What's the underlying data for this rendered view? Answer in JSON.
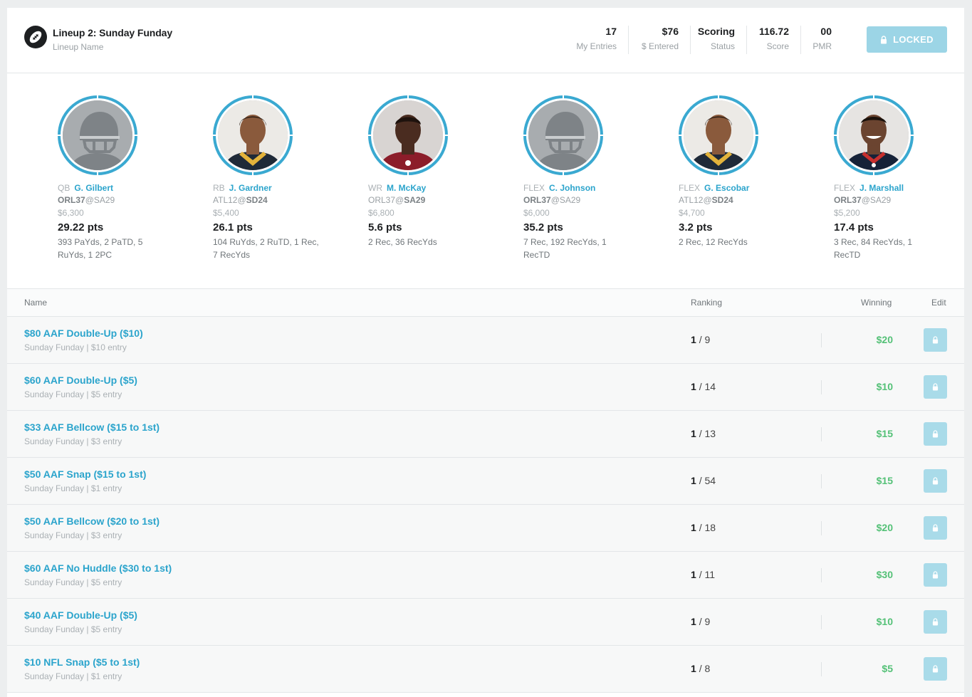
{
  "header": {
    "lineup_title": "Lineup 2: Sunday Funday",
    "lineup_label": "Lineup Name",
    "stats": [
      {
        "value": "17",
        "label": "My Entries"
      },
      {
        "value": "$76",
        "label": "$ Entered"
      },
      {
        "value": "Scoring",
        "label": "Status"
      },
      {
        "value": "116.72",
        "label": "Score"
      },
      {
        "value": "00",
        "label": "PMR"
      }
    ],
    "locked_label": "LOCKED"
  },
  "players": [
    {
      "pos": "QB",
      "name": "G. Gilbert",
      "team_left": "ORL37",
      "team_at": "@",
      "team_right": "SA29",
      "bold_side": "left",
      "salary": "$6,300",
      "pts": "29.22 pts",
      "stats": "393 PaYds, 2 PaTD, 5 RuYds, 1 2PC",
      "photo": "placeholder"
    },
    {
      "pos": "RB",
      "name": "J. Gardner",
      "team_left": "ATL12",
      "team_at": "@",
      "team_right": "SD24",
      "bold_side": "right",
      "salary": "$5,400",
      "pts": "26.1 pts",
      "stats": "104 RuYds, 2 RuTD, 1 Rec, 7 RecYds",
      "photo": "headshot-gold"
    },
    {
      "pos": "WR",
      "name": "M. McKay",
      "team_left": "ORL37",
      "team_at": "@",
      "team_right": "SA29",
      "bold_side": "right",
      "salary": "$6,800",
      "pts": "5.6 pts",
      "stats": "2 Rec, 36 RecYds",
      "photo": "headshot-red"
    },
    {
      "pos": "FLEX",
      "name": "C. Johnson",
      "team_left": "ORL37",
      "team_at": "@",
      "team_right": "SA29",
      "bold_side": "left",
      "salary": "$6,000",
      "pts": "35.2 pts",
      "stats": "7 Rec, 192 RecYds, 1 RecTD",
      "photo": "placeholder"
    },
    {
      "pos": "FLEX",
      "name": "G. Escobar",
      "team_left": "ATL12",
      "team_at": "@",
      "team_right": "SD24",
      "bold_side": "right",
      "salary": "$4,700",
      "pts": "3.2 pts",
      "stats": "2 Rec, 12 RecYds",
      "photo": "headshot-gold"
    },
    {
      "pos": "FLEX",
      "name": "J. Marshall",
      "team_left": "ORL37",
      "team_at": "@",
      "team_right": "SA29",
      "bold_side": "left",
      "salary": "$5,200",
      "pts": "17.4 pts",
      "stats": "3 Rec, 84 RecYds, 1 RecTD",
      "photo": "headshot-navy"
    }
  ],
  "table": {
    "columns": {
      "name": "Name",
      "ranking": "Ranking",
      "winning": "Winning",
      "edit": "Edit"
    },
    "rows": [
      {
        "name": "$80 AAF Double-Up ($10)",
        "sub": "Sunday Funday | $10 entry",
        "rank": "1",
        "of": "/ 9",
        "win": "$20"
      },
      {
        "name": "$60 AAF Double-Up ($5)",
        "sub": "Sunday Funday | $5 entry",
        "rank": "1",
        "of": "/ 14",
        "win": "$10"
      },
      {
        "name": "$33 AAF Bellcow ($15 to 1st)",
        "sub": "Sunday Funday | $3 entry",
        "rank": "1",
        "of": "/ 13",
        "win": "$15"
      },
      {
        "name": "$50 AAF Snap ($15 to 1st)",
        "sub": "Sunday Funday | $1 entry",
        "rank": "1",
        "of": "/ 54",
        "win": "$15"
      },
      {
        "name": "$50 AAF Bellcow ($20 to 1st)",
        "sub": "Sunday Funday | $3 entry",
        "rank": "1",
        "of": "/ 18",
        "win": "$20"
      },
      {
        "name": "$60 AAF No Huddle ($30 to 1st)",
        "sub": "Sunday Funday | $5 entry",
        "rank": "1",
        "of": "/ 11",
        "win": "$30"
      },
      {
        "name": "$40 AAF Double-Up ($5)",
        "sub": "Sunday Funday | $5 entry",
        "rank": "1",
        "of": "/ 9",
        "win": "$10"
      },
      {
        "name": "$10 NFL Snap ($5 to 1st)",
        "sub": "Sunday Funday | $1 entry",
        "rank": "1",
        "of": "/ 8",
        "win": "$5"
      }
    ]
  },
  "colors": {
    "accent": "#2ba4cc",
    "win": "#54c177",
    "locked": "#9cd5e6"
  }
}
